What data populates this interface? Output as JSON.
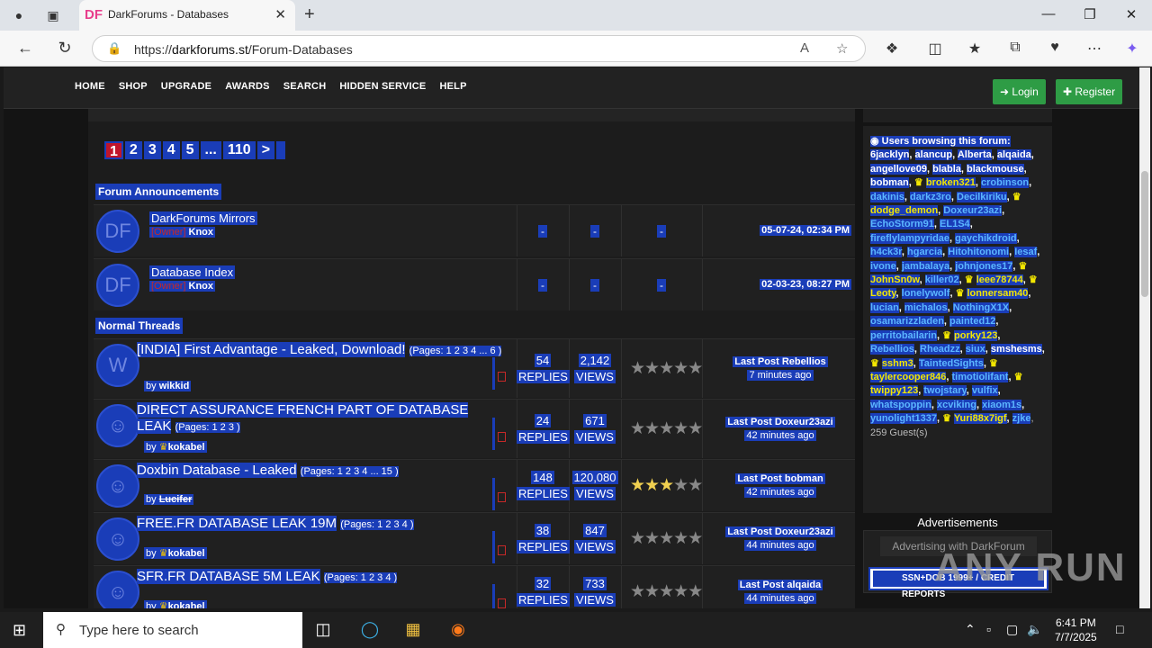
{
  "browser": {
    "tab_title": "DarkForums - Databases",
    "tab_favicon": "DF",
    "url_scheme": "https://",
    "url_host": "darkforums.st",
    "url_path": "/Forum-Databases"
  },
  "nav": {
    "links": [
      "HOME",
      "SHOP",
      "UPGRADE",
      "AWARDS",
      "SEARCH",
      "HIDDEN SERVICE",
      "HELP"
    ],
    "login": "Login",
    "register": "Register"
  },
  "pagination": {
    "pages": [
      "1",
      "2",
      "3",
      "4",
      "5",
      "...",
      "110"
    ],
    "current": "1",
    "next": ">"
  },
  "announcements": {
    "heading": "Forum Announcements",
    "items": [
      {
        "title": "DarkForums Mirrors",
        "role": "[Owner]",
        "author": "Knox",
        "replies": "-",
        "views": "-",
        "rating": "-",
        "date": "05-07-24, 02:34 PM"
      },
      {
        "title": "Database Index",
        "role": "[Owner]",
        "author": "Knox",
        "replies": "-",
        "views": "-",
        "rating": "-",
        "date": "02-03-23, 08:27 PM"
      }
    ]
  },
  "threads": {
    "heading": "Normal Threads",
    "items": [
      {
        "title": "[INDIA] First Advantage - Leaked, Download!",
        "pages": "(Pages: 1 2 3 4 ... 6 )",
        "by": "by",
        "author": "wikkid",
        "crown": false,
        "strike": false,
        "replies": "54",
        "replies_label": "REPLIES",
        "views": "2,142",
        "views_label": "VIEWS",
        "stars": 0,
        "last_label": "Last Post",
        "last_user": "Rebellios",
        "last_time": "7 minutes ago"
      },
      {
        "title": "DIRECT ASSURANCE FRENCH PART OF DATABASE LEAK",
        "pages": "(Pages: 1 2 3 )",
        "by": "by",
        "author": "kokabel",
        "crown": true,
        "strike": false,
        "replies": "24",
        "replies_label": "REPLIES",
        "views": "671",
        "views_label": "VIEWS",
        "stars": 0,
        "last_label": "Last Post",
        "last_user": "Doxeur23azi",
        "last_time": "42 minutes ago"
      },
      {
        "title": "Doxbin Database - Leaked",
        "pages": "(Pages: 1 2 3 4 ... 15 )",
        "by": "by",
        "author": "Lucifer",
        "crown": false,
        "strike": true,
        "replies": "148",
        "replies_label": "REPLIES",
        "views": "120,080",
        "views_label": "VIEWS",
        "stars": 3,
        "last_label": "Last Post",
        "last_user": "bobman",
        "last_time": "42 minutes ago"
      },
      {
        "title": "FREE.FR DATABASE LEAK 19M",
        "pages": "(Pages: 1 2 3 4 )",
        "by": "by",
        "author": "kokabel",
        "crown": true,
        "strike": false,
        "replies": "38",
        "replies_label": "REPLIES",
        "views": "847",
        "views_label": "VIEWS",
        "stars": 0,
        "last_label": "Last Post",
        "last_user": "Doxeur23azi",
        "last_time": "44 minutes ago"
      },
      {
        "title": "SFR.FR DATABASE 5M LEAK",
        "pages": "(Pages: 1 2 3 4 )",
        "by": "by",
        "author": "kokabel",
        "crown": true,
        "strike": false,
        "replies": "32",
        "replies_label": "REPLIES",
        "views": "733",
        "views_label": "VIEWS",
        "stars": 0,
        "last_label": "Last Post",
        "last_user": "alqaida",
        "last_time": "44 minutes ago"
      }
    ]
  },
  "sidebar": {
    "browsing_label": "Users browsing this forum:",
    "users": [
      {
        "n": "6jacklyn",
        "c": "w"
      },
      {
        "n": "alancup",
        "c": "w"
      },
      {
        "n": "Alberta",
        "c": "w"
      },
      {
        "n": "alqaida",
        "c": "w"
      },
      {
        "n": "angellove09",
        "c": "w"
      },
      {
        "n": "blabla",
        "c": "w"
      },
      {
        "n": "blackmouse",
        "c": "w"
      },
      {
        "n": "bobman",
        "c": "w"
      },
      {
        "n": "broken321",
        "c": "y",
        "crown": true
      },
      {
        "n": "crobinson",
        "c": "c"
      },
      {
        "n": "dakinis",
        "c": "c"
      },
      {
        "n": "darkz3ro",
        "c": "c"
      },
      {
        "n": "Decilkiriku",
        "c": "c"
      },
      {
        "n": "dodge_demon",
        "c": "y",
        "crown": true
      },
      {
        "n": "Doxeur23azi",
        "c": "c"
      },
      {
        "n": "EchoStorm91",
        "c": "c"
      },
      {
        "n": "EL1S4",
        "c": "c"
      },
      {
        "n": "fireflylampyridae",
        "c": "c"
      },
      {
        "n": "gaychikdroid",
        "c": "c"
      },
      {
        "n": "h4ck3r",
        "c": "c"
      },
      {
        "n": "hgarcia",
        "c": "c"
      },
      {
        "n": "Hitohitonomi",
        "c": "c"
      },
      {
        "n": "Iesaf",
        "c": "c"
      },
      {
        "n": "ivone",
        "c": "c"
      },
      {
        "n": "jambalaya",
        "c": "c"
      },
      {
        "n": "johnjones17",
        "c": "c"
      },
      {
        "n": "JohnSn0w",
        "c": "y",
        "crown": true
      },
      {
        "n": "killer02",
        "c": "c"
      },
      {
        "n": "leee78744",
        "c": "y",
        "crown": true
      },
      {
        "n": "Leoty",
        "c": "y",
        "crown": true
      },
      {
        "n": "lonelywolf",
        "c": "c"
      },
      {
        "n": "lonnersam40",
        "c": "y",
        "crown": true
      },
      {
        "n": "lucian",
        "c": "c"
      },
      {
        "n": "michalos",
        "c": "c"
      },
      {
        "n": "NothingX1X",
        "c": "c"
      },
      {
        "n": "osamarizzladen",
        "c": "c"
      },
      {
        "n": "painted12",
        "c": "c"
      },
      {
        "n": "perritobailarin",
        "c": "c"
      },
      {
        "n": "porky123",
        "c": "y",
        "crown": true
      },
      {
        "n": "Rebellios",
        "c": "c"
      },
      {
        "n": "Rheadzz",
        "c": "c"
      },
      {
        "n": "siux",
        "c": "c"
      },
      {
        "n": "smshesms",
        "c": "w"
      },
      {
        "n": "sshm3",
        "c": "y",
        "crown": true
      },
      {
        "n": "TaintedSights",
        "c": "c"
      },
      {
        "n": "taylercooper846",
        "c": "y",
        "crown": true
      },
      {
        "n": "timotiolifant",
        "c": "c"
      },
      {
        "n": "twippy123",
        "c": "y",
        "crown": true
      },
      {
        "n": "twojstary",
        "c": "c"
      },
      {
        "n": "vulfix",
        "c": "c"
      },
      {
        "n": "whatspoppin",
        "c": "c"
      },
      {
        "n": "xcviking",
        "c": "c"
      },
      {
        "n": "xiaom1s",
        "c": "c"
      },
      {
        "n": "yunolight1337",
        "c": "c"
      },
      {
        "n": "Yuri88x7igf",
        "c": "y",
        "crown": true
      },
      {
        "n": "zjke",
        "c": "c"
      }
    ],
    "guests": ", 259 Guest(s)",
    "ads_heading": "Advertisements",
    "ads_button": "Advertising with DarkForum",
    "ads_banner": "SSN+DOB 1999+ / CREDIT REPORTS"
  },
  "watermark": "ANY RUN",
  "taskbar": {
    "search_placeholder": "Type here to search",
    "time": "6:41 PM",
    "date": "7/7/2025"
  },
  "colors": {
    "selection": "#1a3db8",
    "green": "#2e9c45",
    "owner_red": "#c62828",
    "crown_yellow": "#f3e700"
  }
}
